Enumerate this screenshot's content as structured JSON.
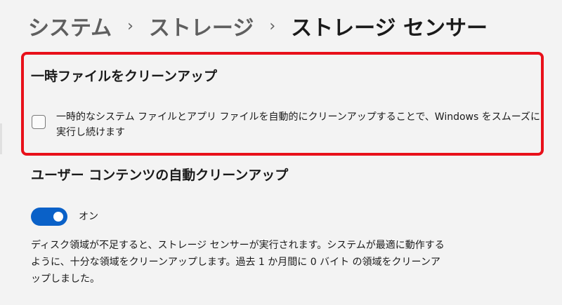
{
  "breadcrumb": {
    "items": [
      "システム",
      "ストレージ"
    ],
    "separator": "›",
    "current": "ストレージ センサー"
  },
  "temp_cleanup": {
    "title": "一時ファイルをクリーンアップ",
    "checkbox_checked": false,
    "checkbox_label": "一時的なシステム ファイルとアプリ ファイルを自動的にクリーンアップすることで、Windows をスムーズに実行し続けます"
  },
  "user_content": {
    "title": "ユーザー コンテンツの自動クリーンアップ",
    "toggle_on": true,
    "toggle_label": "オン",
    "description": "ディスク領域が不足すると、ストレージ センサーが実行されます。システムが最適に動作するように、十分な領域をクリーンアップします。過去 1 か月間に 0 バイト の領域をクリーンアップしました。"
  },
  "colors": {
    "highlight": "#e8101a",
    "toggle_accent": "#0a61c8"
  }
}
